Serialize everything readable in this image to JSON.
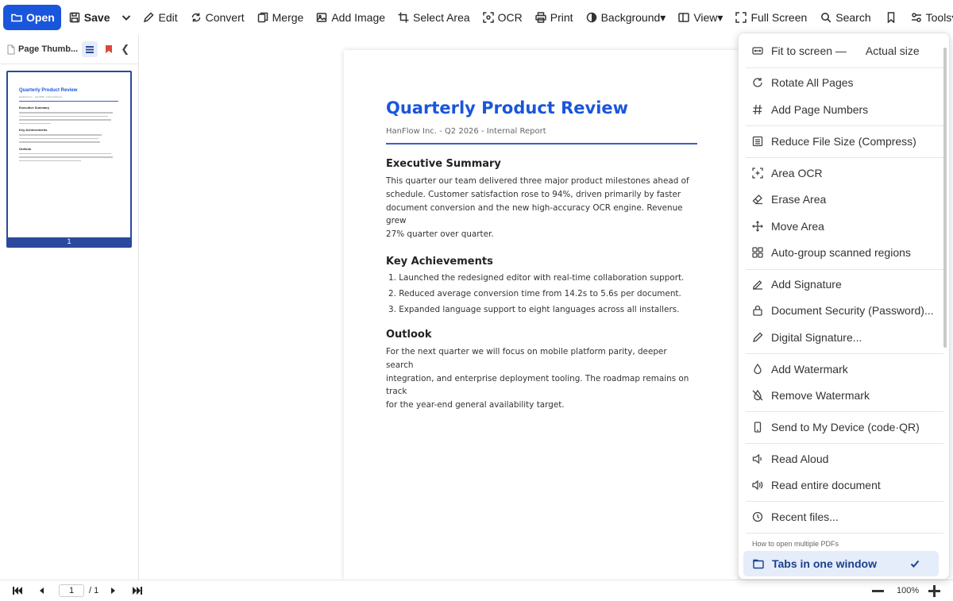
{
  "toolbar": {
    "open": "Open",
    "save": "Save",
    "edit": "Edit",
    "convert": "Convert",
    "merge": "Merge",
    "add_image": "Add Image",
    "select_area": "Select Area",
    "ocr": "OCR",
    "print": "Print",
    "background": "Background▾",
    "view": "View▾",
    "full_screen": "Full Screen",
    "search": "Search",
    "tools": "Tools▾"
  },
  "sidebar": {
    "title": "Page Thumb...",
    "thumbnail": {
      "title": "Quarterly Product Review",
      "subtitle": "HanFlow Inc. - Q2 2026 - Internal Report",
      "heading1": "Executive Summary",
      "heading2": "Key Achievements",
      "heading3": "Outlook",
      "page_number": "1"
    }
  },
  "document": {
    "title": "Quarterly Product Review",
    "subtitle": "HanFlow Inc. - Q2 2026 - Internal Report",
    "sections": {
      "summary_heading": "Executive Summary",
      "summary_lines": [
        "This quarter our team delivered three major product milestones ahead of",
        "schedule. Customer satisfaction rose to 94%, driven primarily by faster",
        "document conversion and the new high-accuracy OCR engine. Revenue grew",
        "27% quarter over quarter."
      ],
      "achievements_heading": "Key Achievements",
      "achievements": [
        "1.  Launched the redesigned editor with real-time collaboration support.",
        "2.  Reduced average conversion time from 14.2s to 5.6s per document.",
        "3.  Expanded language support to eight languages across all installers."
      ],
      "outlook_heading": "Outlook",
      "outlook_lines": [
        "For the next quarter we will focus on mobile platform parity, deeper search",
        "integration, and enterprise deployment tooling. The roadmap remains on track",
        "for the year-end general availability target."
      ]
    }
  },
  "bottombar": {
    "current_page": "1",
    "total_pages": "/  1",
    "zoom": "100%"
  },
  "tools_menu": {
    "fit_to_screen": "Fit to screen —",
    "actual_size": "Actual size",
    "rotate_all": "Rotate All Pages",
    "add_page_numbers": "Add Page Numbers",
    "reduce_size": "Reduce File Size (Compress)",
    "area_ocr": "Area OCR",
    "erase_area": "Erase Area",
    "move_area": "Move Area",
    "auto_group": "Auto-group scanned regions",
    "add_signature": "Add Signature",
    "doc_security": "Document Security (Password)...",
    "digital_signature": "Digital Signature...",
    "add_watermark": "Add Watermark",
    "remove_watermark": "Remove Watermark",
    "send_to_device": "Send to My Device (code·QR)",
    "read_aloud": "Read Aloud",
    "read_entire": "Read entire document",
    "recent_files": "Recent files...",
    "multi_pdf_label": "How to open multiple PDFs",
    "tabs_in_window": "Tabs in one window"
  },
  "colors": {
    "accent": "#1a56db",
    "thumb_border": "#2b4a9e",
    "selected_bg": "#e5edfa"
  }
}
